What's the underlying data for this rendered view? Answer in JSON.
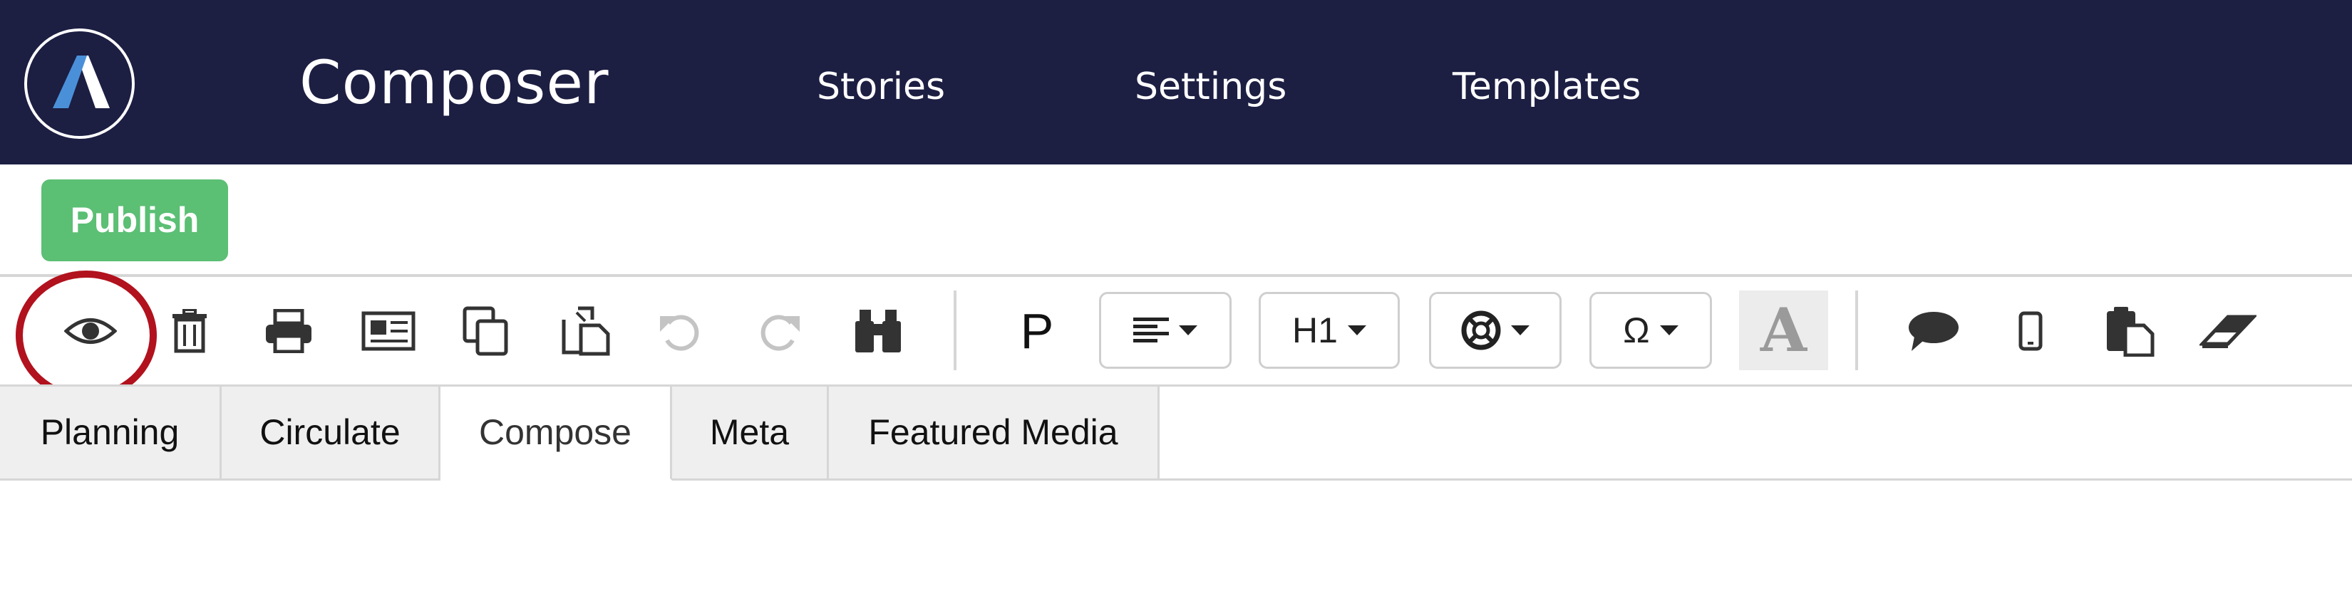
{
  "header": {
    "app_title": "Composer",
    "nav": [
      "Stories",
      "Settings",
      "Templates"
    ],
    "colors": {
      "background": "#1c1e42",
      "logo_accent": "#4a90d9"
    }
  },
  "actions": {
    "publish_label": "Publish",
    "publish_color": "#5bbf74"
  },
  "toolbar": {
    "icons": [
      "eye-icon",
      "trash-icon",
      "print-icon",
      "newspaper-icon",
      "copy-icon",
      "paste-icon",
      "undo-icon",
      "redo-icon",
      "binoculars-icon",
      "comment-icon",
      "mobile-icon",
      "paste-from-word-icon",
      "eraser-icon"
    ],
    "paragraph_label": "P",
    "heading_label": "H1",
    "special_char_label": "Ω",
    "font_color_label": "A",
    "highlight_color": "#b1121d"
  },
  "tabs": [
    "Planning",
    "Circulate",
    "Compose",
    "Meta",
    "Featured Media"
  ],
  "active_tab": "Compose"
}
